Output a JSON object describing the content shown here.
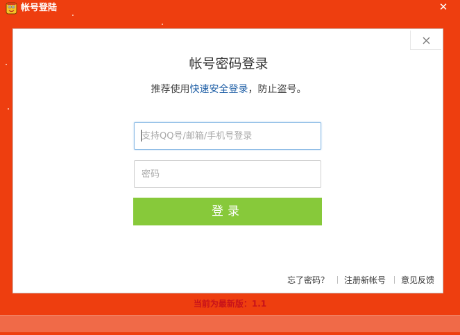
{
  "window": {
    "title": "帐号登陆",
    "close_glyph": "✕",
    "icon": "app-mascot-icon"
  },
  "panel": {
    "close_icon": "close-icon",
    "heading": "帐号密码登录",
    "subheading": {
      "prefix": "推荐使用",
      "link": "快速安全登录",
      "suffix": "，防止盗号。"
    },
    "username_placeholder": "支持QQ号/邮箱/手机号登录",
    "username_value": "",
    "password_placeholder": "密码",
    "password_value": "",
    "login_button": "登录",
    "links": {
      "forgot": "忘了密码？",
      "register": "注册新帐号",
      "feedback": "意见反馈"
    }
  },
  "version_text": "当前为最新版：1.1",
  "colors": {
    "frame": "#ee3e0f",
    "button": "#87c93a",
    "link": "#1f5fa6",
    "version": "#c8121a"
  }
}
